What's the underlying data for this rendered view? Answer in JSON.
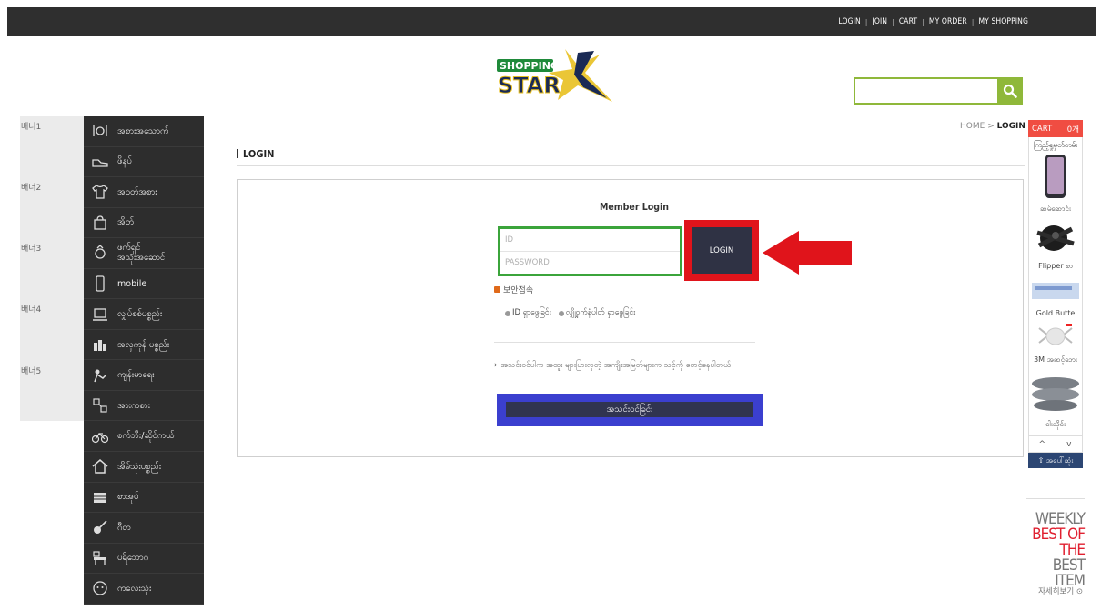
{
  "topnav": [
    "LOGIN",
    "JOIN",
    "CART",
    "MY ORDER",
    "MY SHOPPING"
  ],
  "logo": {
    "line1": "SHOPPING",
    "line2": "STAR",
    "mark": "K"
  },
  "search": {
    "value": "",
    "icon": "search-icon"
  },
  "banners": [
    "배너1",
    "배너2",
    "배너3",
    "배너4",
    "배너5"
  ],
  "categories": [
    {
      "label": "အစားအသောက်",
      "icon": "dining-icon"
    },
    {
      "label": "ဖိနပ်",
      "icon": "shoe-icon"
    },
    {
      "label": "အဝတ်အစား",
      "icon": "shirt-icon"
    },
    {
      "label": "အိတ်",
      "icon": "bag-icon"
    },
    {
      "label": "ဖက်ရှင်\nအသုံးအဆောင်",
      "icon": "accessory-icon"
    },
    {
      "label": "mobile",
      "icon": "mobile-icon"
    },
    {
      "label": "လျှပ်စစ်ပစ္စည်း",
      "icon": "laptop-icon"
    },
    {
      "label": "အလှကုန် ပစ္စည်း",
      "icon": "cosmetics-icon"
    },
    {
      "label": "ကျန်းမာရေး",
      "icon": "health-icon"
    },
    {
      "label": "အားကစား",
      "icon": "sports-icon"
    },
    {
      "label": "စက်ဘီး/ဆိုင်ကယ်",
      "icon": "bicycle-icon"
    },
    {
      "label": "အိမ်သုံးပစ္စည်း",
      "icon": "home-icon"
    },
    {
      "label": "စာအုပ်",
      "icon": "book-icon"
    },
    {
      "label": "ဂီတ",
      "icon": "guitar-icon"
    },
    {
      "label": "ပရိဘောဂ",
      "icon": "furniture-icon"
    },
    {
      "label": "ကလေးသုံး",
      "icon": "baby-icon"
    }
  ],
  "breadcrumb": {
    "home": "HOME",
    "sep": ">",
    "current": "LOGIN"
  },
  "page_title": "LOGIN",
  "login": {
    "heading": "Member Login",
    "id_placeholder": "ID",
    "password_placeholder": "PASSWORD",
    "login_button": "LOGIN",
    "secure_label": "보안접속",
    "find_id": "ID ရှာဖွေခြင်း",
    "find_password": "လျှို့ဝှက်နံပါတ် ရှာဖွေခြင်း",
    "notice": "အသင်းဝင်ပါက အထူး များပြားလှတဲ့ အကျိုးအမြတ်များက သင့်ကို စောင့်နေပါတယ်",
    "join_button": "အသင်းဝင်ခြင်း"
  },
  "sidebar_right": {
    "cart_label": "CART",
    "cart_count": "0개",
    "viewed_title": "ကြည့်ရှုမှတ်တမ်း",
    "products": [
      {
        "name": "ဆမ်ဆောင်း"
      },
      {
        "name": "Flipper စာ"
      },
      {
        "name": "Gold Butte"
      },
      {
        "name": "3M အဆင့်ဘေး"
      },
      {
        "name": "ငါးသိုင်း"
      }
    ],
    "pager_up": "^",
    "pager_down": "v",
    "to_top": "⇧ အပေါ်ဆုံး"
  },
  "weekly": {
    "lines": [
      "WEEKLY",
      "BEST OF THE",
      "BEST ITEM"
    ],
    "more": "자세히보기"
  },
  "colors": {
    "accent_green": "#8fb83a",
    "highlight_red": "#e0141b",
    "highlight_blue": "#3b3fcf",
    "cart_red": "#f04d42"
  }
}
